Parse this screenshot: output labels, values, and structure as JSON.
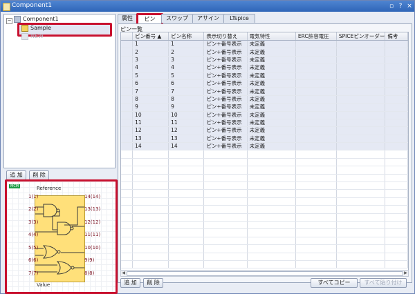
{
  "window": {
    "title": "Component1",
    "pin_btn": "▫",
    "help_btn": "?",
    "close_btn": "×"
  },
  "tree": {
    "root_label": "Component1",
    "items": [
      {
        "label": "Sample"
      },
      {
        "label": "NEW"
      }
    ]
  },
  "left_buttons": {
    "add": "追 加",
    "delete": "削 除"
  },
  "symbol": {
    "badge": "MCM",
    "reference": "Reference",
    "value": "Value",
    "left_pins": [
      "1(1)",
      "2(2)",
      "3(3)",
      "4(4)",
      "5(5)",
      "6(6)",
      "7(7)"
    ],
    "right_pins": [
      "14(14)",
      "13(13)",
      "12(12)",
      "11(11)",
      "10(10)",
      "9(9)",
      "8(8)"
    ]
  },
  "tabs": [
    {
      "label": "属性"
    },
    {
      "label": "ピン"
    },
    {
      "label": "スワップ"
    },
    {
      "label": "アサイン"
    },
    {
      "label": "LTspice"
    }
  ],
  "pin_list": {
    "section_label": "ピン一覧",
    "columns": [
      "ピン番号 ▲",
      "ピン名称",
      "表示切り替え",
      "電気特性",
      "ERC許容電圧",
      "SPICEピンオーダー",
      "備考"
    ],
    "rows": [
      [
        "1",
        "1",
        "ピン+番号表示",
        "未定義",
        "",
        "",
        ""
      ],
      [
        "2",
        "2",
        "ピン+番号表示",
        "未定義",
        "",
        "",
        ""
      ],
      [
        "3",
        "3",
        "ピン+番号表示",
        "未定義",
        "",
        "",
        ""
      ],
      [
        "4",
        "4",
        "ピン+番号表示",
        "未定義",
        "",
        "",
        ""
      ],
      [
        "5",
        "5",
        "ピン+番号表示",
        "未定義",
        "",
        "",
        ""
      ],
      [
        "6",
        "6",
        "ピン+番号表示",
        "未定義",
        "",
        "",
        ""
      ],
      [
        "7",
        "7",
        "ピン+番号表示",
        "未定義",
        "",
        "",
        ""
      ],
      [
        "8",
        "8",
        "ピン+番号表示",
        "未定義",
        "",
        "",
        ""
      ],
      [
        "9",
        "9",
        "ピン+番号表示",
        "未定義",
        "",
        "",
        ""
      ],
      [
        "10",
        "10",
        "ピン+番号表示",
        "未定義",
        "",
        "",
        ""
      ],
      [
        "11",
        "11",
        "ピン+番号表示",
        "未定義",
        "",
        "",
        ""
      ],
      [
        "12",
        "12",
        "ピン+番号表示",
        "未定義",
        "",
        "",
        ""
      ],
      [
        "13",
        "13",
        "ピン+番号表示",
        "未定義",
        "",
        "",
        ""
      ],
      [
        "14",
        "14",
        "ピン+番号表示",
        "未定義",
        "",
        "",
        ""
      ]
    ]
  },
  "bottom_buttons": {
    "add": "追 加",
    "delete": "削 除",
    "copy_all": "すべてコピー",
    "paste_all": "すべて貼り付け"
  },
  "colors": {
    "highlight": "#c8102e",
    "ic_fill": "#ffe07a",
    "pin_color": "#7a1020"
  },
  "icons": {
    "expander": "minus-box-icon",
    "item": "component-icon"
  }
}
